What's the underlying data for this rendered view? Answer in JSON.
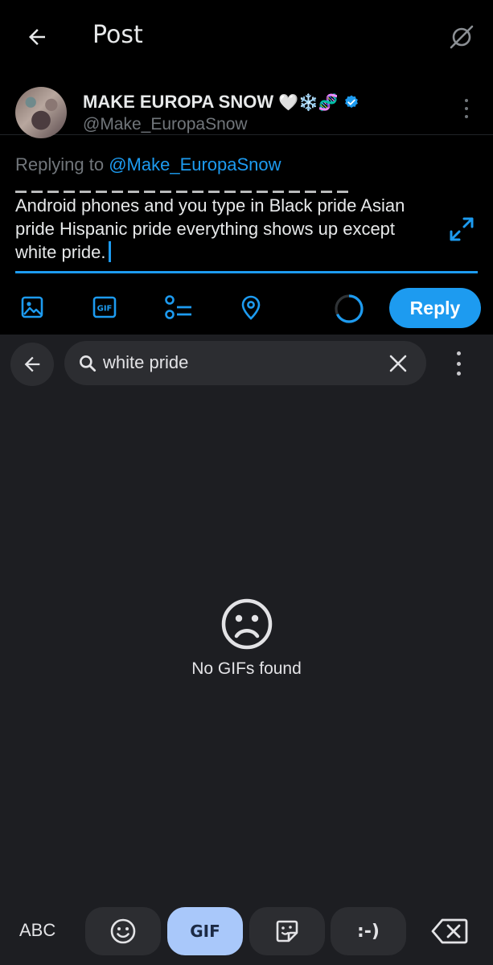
{
  "header": {
    "title": "Post",
    "back_icon": "arrow-left-icon",
    "right_icon": "satellite-off-icon"
  },
  "tweet": {
    "display_name": "MAKE EUROPA SNOW",
    "name_emojis": "🤍❄️🧬",
    "verified": true,
    "handle": "@Make_EuropaSnow"
  },
  "compose": {
    "replying_prefix": "Replying to",
    "replying_to": "@Make_EuropaSnow",
    "text": "Android phones and you type in Black pride Asian pride Hispanic pride everything shows up except white pride."
  },
  "toolbar": {
    "icons": [
      "image-icon",
      "gif-icon",
      "poll-icon",
      "location-icon"
    ],
    "gif_label": "GIF",
    "reply_label": "Reply"
  },
  "keyboard": {
    "search_value": "white pride",
    "empty_message": "No GIFs found",
    "abc_label": "ABC",
    "gif_tab_label": "GIF",
    "emoticon_label": ":-)",
    "active_tab": "GIF"
  },
  "colors": {
    "accent": "#1d9bf0",
    "keyboard_bg": "#1d1e22",
    "active_tab_bg": "#a9c8fa"
  }
}
